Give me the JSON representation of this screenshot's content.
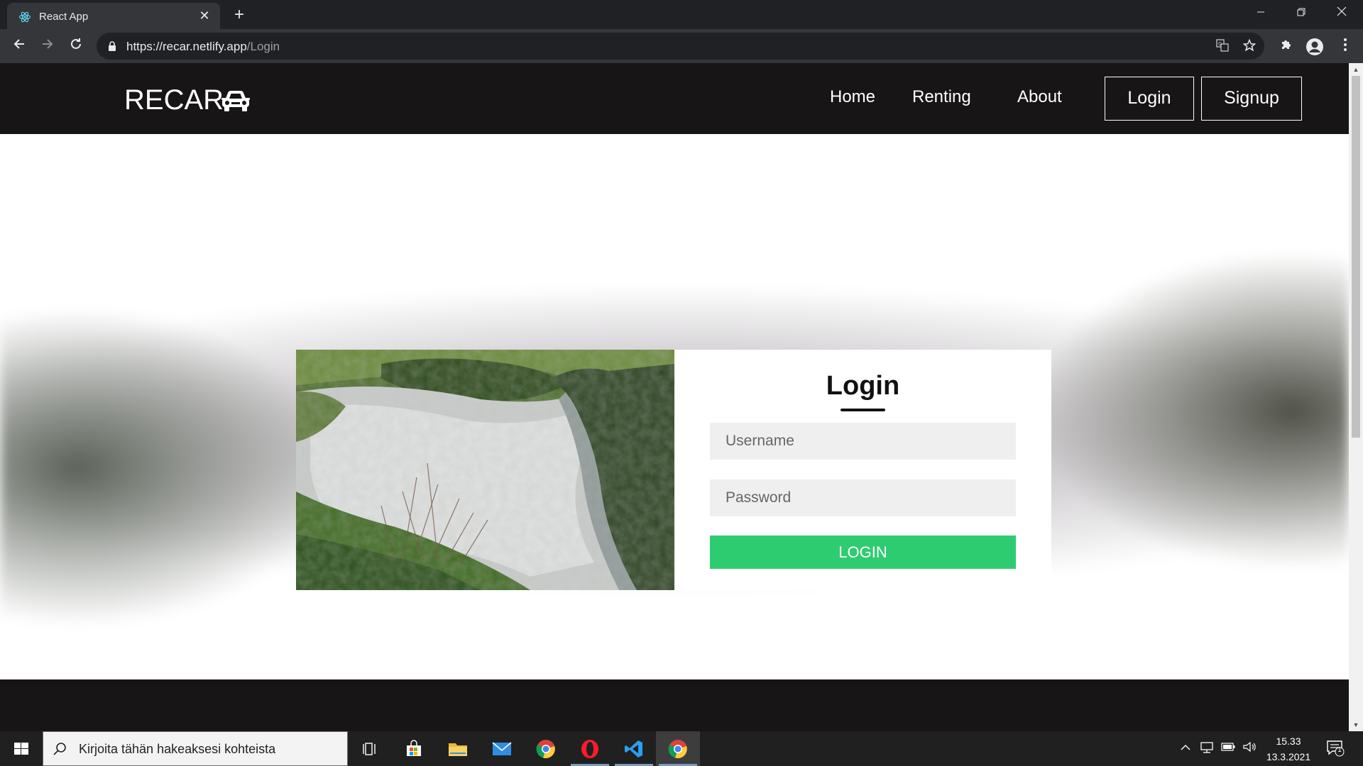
{
  "browser": {
    "tab_title": "React App",
    "tab_close": "✕",
    "new_tab": "+",
    "url_host": "https://recar.netlify.app",
    "url_path": "/Login"
  },
  "site": {
    "brand": "RECAR",
    "nav": {
      "home": "Home",
      "renting": "Renting",
      "about": "About",
      "login": "Login",
      "signup": "Signup"
    }
  },
  "login_form": {
    "title": "Login",
    "username_placeholder": "Username",
    "password_placeholder": "Password",
    "submit_label": "LOGIN"
  },
  "taskbar": {
    "search_placeholder": "Kirjoita tähän hakeaksesi kohteista",
    "time": "15.33",
    "date": "13.3.2021",
    "notification_count": "1"
  },
  "colors": {
    "nav_bg": "#171515",
    "login_button": "#2ecc71"
  }
}
